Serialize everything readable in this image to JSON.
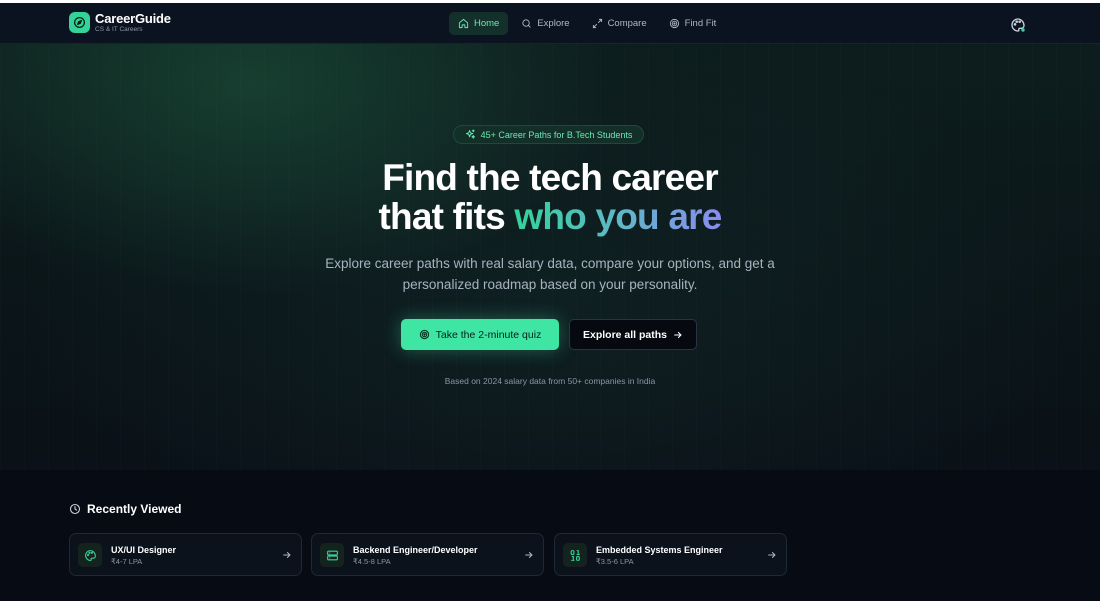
{
  "colors": {
    "accent": "#34d399",
    "accent_light": "#6ee7b7",
    "background": "#070b14",
    "navbar": "#0c1320"
  },
  "brand": {
    "name": "CareerGuide",
    "tagline": "CS & IT Careers",
    "icon": "compass-icon"
  },
  "nav": {
    "items": [
      {
        "label": "Home",
        "icon": "home-icon",
        "active": true
      },
      {
        "label": "Explore",
        "icon": "search-icon",
        "active": false
      },
      {
        "label": "Compare",
        "icon": "compare-arrows-icon",
        "active": false
      },
      {
        "label": "Find Fit",
        "icon": "target-icon",
        "active": false
      }
    ],
    "theme_icon": "palette-icon"
  },
  "hero": {
    "badge": "45+ Career Paths for B.Tech Students",
    "headline_line1": "Find the tech career",
    "headline_line2_plain": "that fits ",
    "headline_line2_highlight": "who you are",
    "subtitle": "Explore career paths with real salary data, compare your options, and get a personalized roadmap based on your personality.",
    "primary_button": "Take the 2-minute quiz",
    "secondary_button": "Explore all paths",
    "note": "Based on 2024 salary data from 50+ companies in India"
  },
  "recently_viewed": {
    "title": "Recently Viewed",
    "items": [
      {
        "title": "UX/UI Designer",
        "salary": "₹4-7 LPA",
        "icon": "palette-icon"
      },
      {
        "title": "Backend Engineer/Developer",
        "salary": "₹4.5-8 LPA",
        "icon": "server-icon"
      },
      {
        "title": "Embedded Systems Engineer",
        "salary": "₹3.5-6 LPA",
        "icon": "binary-icon"
      }
    ]
  }
}
